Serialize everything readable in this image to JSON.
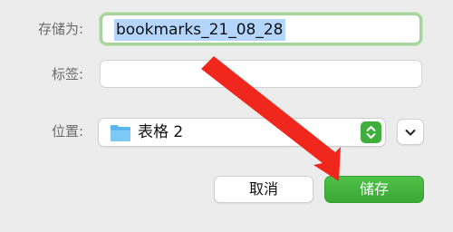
{
  "save_dialog": {
    "save_as_label": "存储为:",
    "save_as_value": "bookmarks_21_08_28",
    "tags_label": "标签:",
    "tags_value": "",
    "location_label": "位置:",
    "location_value": "表格 2",
    "location_icon": "folder-icon",
    "expand_icon": "chevron-down-icon",
    "cancel_label": "取消",
    "save_label": "储存"
  },
  "colors": {
    "accent_green": "#3fae3c",
    "selection_blue": "#b4d5fe",
    "annotation_red": "#f0271c",
    "folder_blue": "#5ab4ee"
  },
  "annotation": {
    "type": "arrow",
    "color": "#f0271c"
  }
}
